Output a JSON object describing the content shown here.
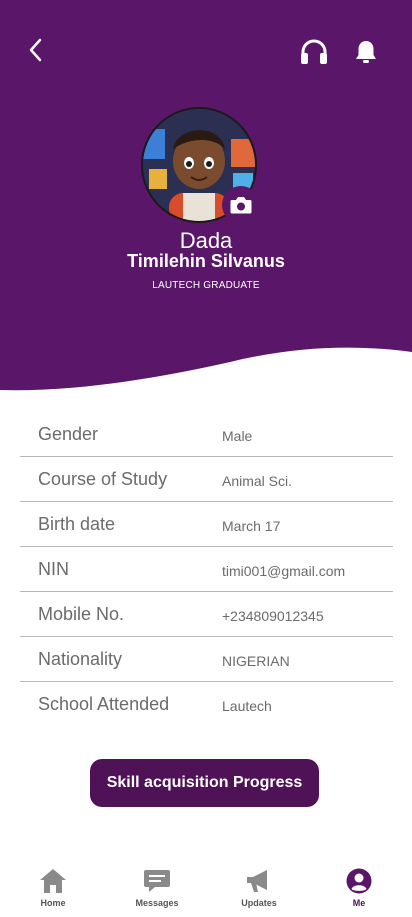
{
  "colors": {
    "primary": "#5a1668",
    "button": "#4f1256",
    "muted": "#6b6b6b"
  },
  "header": {
    "back_icon": "chevron-left-icon",
    "support_icon": "headphones-icon",
    "notification_icon": "bell-icon"
  },
  "profile": {
    "first_name": "Dada",
    "full_name": "Timilehin Silvanus",
    "subtitle": "LAUTECH GRADUATE",
    "camera_icon": "camera-icon"
  },
  "details": [
    {
      "label": "Gender",
      "value": "Male"
    },
    {
      "label": "Course of Study",
      "value": "Animal Sci."
    },
    {
      "label": "Birth date",
      "value": "March 17"
    },
    {
      "label": "NIN",
      "value": "timi001@gmail.com"
    },
    {
      "label": "Mobile No.",
      "value": "+234809012345"
    },
    {
      "label": "Nationality",
      "value": "NIGERIAN"
    },
    {
      "label": "School Attended",
      "value": "Lautech"
    }
  ],
  "cta": {
    "label": "Skill acquisition Progress"
  },
  "nav": [
    {
      "label": "Home",
      "icon": "home-icon"
    },
    {
      "label": "Messages",
      "icon": "message-icon"
    },
    {
      "label": "Updates",
      "icon": "megaphone-icon"
    },
    {
      "label": "Me",
      "icon": "profile-icon",
      "active": true
    }
  ]
}
